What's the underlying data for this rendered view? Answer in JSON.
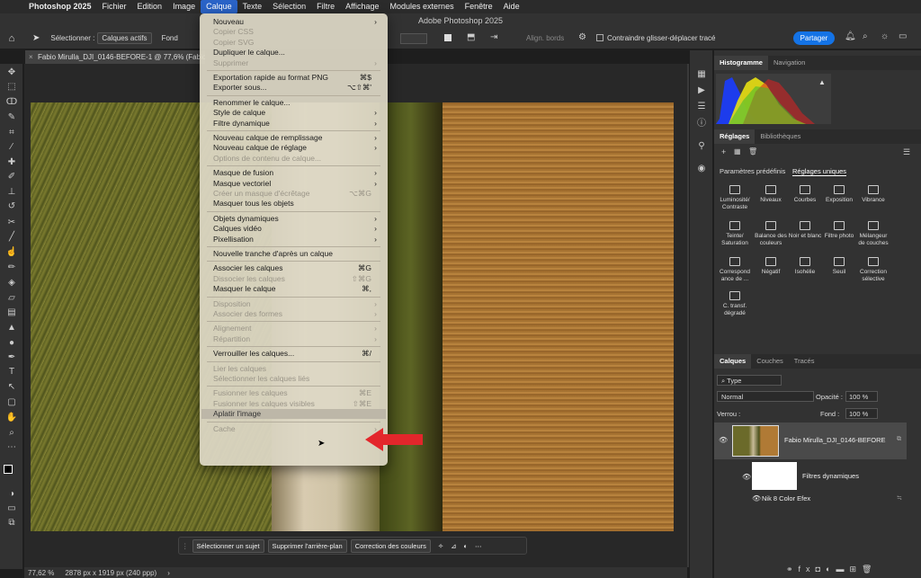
{
  "menubar": {
    "app": "Photoshop 2025",
    "items": [
      "Fichier",
      "Edition",
      "Image",
      "Calque",
      "Texte",
      "Sélection",
      "Filtre",
      "Affichage",
      "Modules externes",
      "Fenêtre",
      "Aide"
    ],
    "active": "Calque"
  },
  "window_title": "Adobe Photoshop 2025",
  "optbar": {
    "select_label": "Sélectionner :",
    "select_value": "Calques actifs",
    "fond_label": "Fond",
    "align_label": "Align. bords",
    "constrain_label": "Contraindre glisser-déplacer tracé",
    "share_label": "Partager"
  },
  "doc_tab": "Fabio Mirulla_DJI_0146-BEFORE-1 @ 77,6% (Fabio",
  "status": {
    "zoom": "77,62 %",
    "dimensions": "2878 px x 1919 px (240 ppp)"
  },
  "taskbar": {
    "select_subject": "Sélectionner un sujet",
    "remove_bg": "Supprimer l'arrière-plan",
    "color_correction": "Correction des couleurs"
  },
  "menu": {
    "items": [
      {
        "label": "Nouveau",
        "arrow": true
      },
      {
        "label": "Copier CSS",
        "disabled": true
      },
      {
        "label": "Copier SVG",
        "disabled": true
      },
      {
        "label": "Dupliquer le calque..."
      },
      {
        "label": "Supprimer",
        "disabled": true,
        "arrow": true
      },
      {
        "sep": true
      },
      {
        "label": "Exportation rapide au format PNG",
        "shortcut": "⌘$"
      },
      {
        "label": "Exporter sous...",
        "shortcut": "⌥⇧⌘'"
      },
      {
        "sep": true
      },
      {
        "label": "Renommer le calque..."
      },
      {
        "label": "Style de calque",
        "arrow": true
      },
      {
        "label": "Filtre dynamique",
        "arrow": true
      },
      {
        "sep": true
      },
      {
        "label": "Nouveau calque de remplissage",
        "arrow": true
      },
      {
        "label": "Nouveau calque de réglage",
        "arrow": true
      },
      {
        "label": "Options de contenu de calque...",
        "disabled": true
      },
      {
        "sep": true
      },
      {
        "label": "Masque de fusion",
        "arrow": true
      },
      {
        "label": "Masque vectoriel",
        "arrow": true
      },
      {
        "label": "Créer un masque d'écrêtage",
        "disabled": true,
        "shortcut": "⌥⌘G"
      },
      {
        "label": "Masquer tous les objets"
      },
      {
        "sep": true
      },
      {
        "label": "Objets dynamiques",
        "arrow": true
      },
      {
        "label": "Calques vidéo",
        "arrow": true
      },
      {
        "label": "Pixellisation",
        "arrow": true
      },
      {
        "sep": true
      },
      {
        "label": "Nouvelle tranche d'après un calque"
      },
      {
        "sep": true
      },
      {
        "label": "Associer les calques",
        "shortcut": "⌘G"
      },
      {
        "label": "Dissocier les calques",
        "disabled": true,
        "shortcut": "⇧⌘G"
      },
      {
        "label": "Masquer le calque",
        "shortcut": "⌘,"
      },
      {
        "sep": true
      },
      {
        "label": "Disposition",
        "disabled": true,
        "arrow": true
      },
      {
        "label": "Associer des formes",
        "disabled": true,
        "arrow": true
      },
      {
        "sep": true
      },
      {
        "label": "Alignement",
        "disabled": true,
        "arrow": true
      },
      {
        "label": "Répartition",
        "disabled": true,
        "arrow": true
      },
      {
        "sep": true
      },
      {
        "label": "Verrouiller les calques...",
        "shortcut": "⌘/"
      },
      {
        "sep": true
      },
      {
        "label": "Lier les calques",
        "disabled": true
      },
      {
        "label": "Sélectionner les calques liés",
        "disabled": true
      },
      {
        "sep": true
      },
      {
        "label": "Fusionner les calques",
        "disabled": true,
        "shortcut": "⌘E"
      },
      {
        "label": "Fusionner les calques visibles",
        "disabled": true,
        "shortcut": "⇧⌘E"
      },
      {
        "label": "Aplatir l'image",
        "highlight": true
      },
      {
        "sep": true
      },
      {
        "label": "Cache",
        "disabled": true,
        "arrow": true
      }
    ]
  },
  "panels": {
    "hist_tabs": [
      "Histogramme",
      "Navigation"
    ],
    "adj_tabs": [
      "Réglages",
      "Bibliothèques"
    ],
    "adj_subtabs": [
      "Paramètres prédéfinis",
      "Réglages uniques"
    ],
    "adjustments": [
      "Luminosité/ Contraste",
      "Niveaux",
      "Courbes",
      "Exposition",
      "Vibrance",
      "Teinte/ Saturation",
      "Balance des couleurs",
      "Noir et blanc",
      "Filtre photo",
      "Mélangeur de couches",
      "Correspond ance de ...",
      "Négatif",
      "Isohélie",
      "Seuil",
      "Correction sélective",
      "C. transf. dégradé"
    ],
    "layer_tabs": [
      "Calques",
      "Couches",
      "Tracés"
    ],
    "type_filter": "Type",
    "blend_mode": "Normal",
    "opacity_label": "Opacité :",
    "opacity_value": "100 %",
    "lock_label": "Verrou :",
    "fill_label": "Fond :",
    "fill_value": "100 %",
    "layer_name": "Fabio Mirulla_DJI_0146-BEFORE",
    "smart_filters": "Filtres dynamiques",
    "filter_name": "Nik 8 Color Efex"
  },
  "colors": {
    "accent": "#2a63c7",
    "share": "#1473e6",
    "arrow": "#e3262b"
  }
}
